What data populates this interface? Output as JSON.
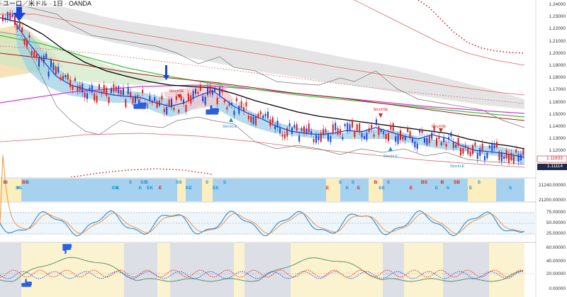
{
  "title": "ユーロ／米ドル · 1日 · OANDA",
  "price_axis": [
    "1.24000",
    "1.23000",
    "1.22000",
    "1.21000",
    "1.20000",
    "1.19000",
    "1.18000",
    "1.17000",
    "1.16000",
    "1.15000",
    "1.14000",
    "1.13000",
    "1.12000"
  ],
  "last_prices": {
    "upper": "1.11833",
    "lower": "1.11114"
  },
  "signals_axis": [
    "21240.00000",
    "21200.00000"
  ],
  "osc_axis": [
    "75.00000",
    "50.00000",
    "25.00000"
  ],
  "adx_axis": [
    "60.00000",
    "40.00000",
    "20.00000",
    "0.00000"
  ],
  "strategy_labels": [
    {
      "text": "StockLE",
      "color": "#1f8fd6"
    },
    {
      "text": "StockLE",
      "color": "#1f8fd6"
    },
    {
      "text": "StockSE",
      "color": "#d62020"
    },
    {
      "text": "StockSE",
      "color": "#d62020"
    },
    {
      "text": "StockSE",
      "color": "#d62020"
    },
    {
      "text": "StockLE",
      "color": "#1f8fd6"
    }
  ],
  "signal_markers": [
    {
      "text": "B",
      "color": "#d62020"
    },
    {
      "text": "K",
      "color": "#1f8fd6"
    },
    {
      "text": "BS",
      "color": "#d62020"
    },
    {
      "text": "EK",
      "color": "#1f8fd6"
    },
    {
      "text": "S",
      "color": "#1f8fd6"
    },
    {
      "text": "K",
      "color": "#1f8fd6"
    },
    {
      "text": "S",
      "color": "#1f8fd6"
    },
    {
      "text": "E",
      "color": "#d62020"
    },
    {
      "text": "SS",
      "color": "#1f8fd6"
    },
    {
      "text": "KE",
      "color": "#1f8fd6"
    },
    {
      "text": "S",
      "color": "#1f8fd6"
    },
    {
      "text": "EK",
      "color": "#1f8fd6"
    },
    {
      "text": "S",
      "color": "#1f8fd6"
    },
    {
      "text": "E",
      "color": "#d62020"
    },
    {
      "text": "S",
      "color": "#1f8fd6"
    },
    {
      "text": "K",
      "color": "#1f8fd6"
    },
    {
      "text": "S",
      "color": "#1f8fd6"
    },
    {
      "text": "E",
      "color": "#d62020"
    },
    {
      "text": "B",
      "color": "#d62020"
    },
    {
      "text": "SS",
      "color": "#1f8fd6"
    },
    {
      "text": "S",
      "color": "#1f8fd6"
    },
    {
      "text": "E",
      "color": "#d62020"
    },
    {
      "text": "BS",
      "color": "#d62020"
    },
    {
      "text": "E",
      "color": "#1f8fd6"
    },
    {
      "text": "B",
      "color": "#d62020"
    },
    {
      "text": "S",
      "color": "#1f8fd6"
    },
    {
      "text": "SB",
      "color": "#d62020"
    },
    {
      "text": "E",
      "color": "#1f8fd6"
    },
    {
      "text": "S",
      "color": "#1f8fd6"
    },
    {
      "text": "S",
      "color": "#1f8fd6"
    },
    {
      "text": "S",
      "color": "#1f8fd6"
    },
    {
      "text": "SS",
      "color": "#1f8fd6"
    },
    {
      "text": "S",
      "color": "#1f8fd6"
    },
    {
      "text": "K",
      "color": "#1f8fd6"
    },
    {
      "text": "SS",
      "color": "#1f8fd6"
    },
    {
      "text": "EK",
      "color": "#1f8fd6"
    }
  ],
  "colors": {
    "up": "#1a43d8",
    "down": "#d62020",
    "ma_black": "#000000",
    "green": "#3cc23c",
    "magenta": "#d23cd2",
    "red": "#e06060",
    "blueline": "#1f8fd6"
  }
}
